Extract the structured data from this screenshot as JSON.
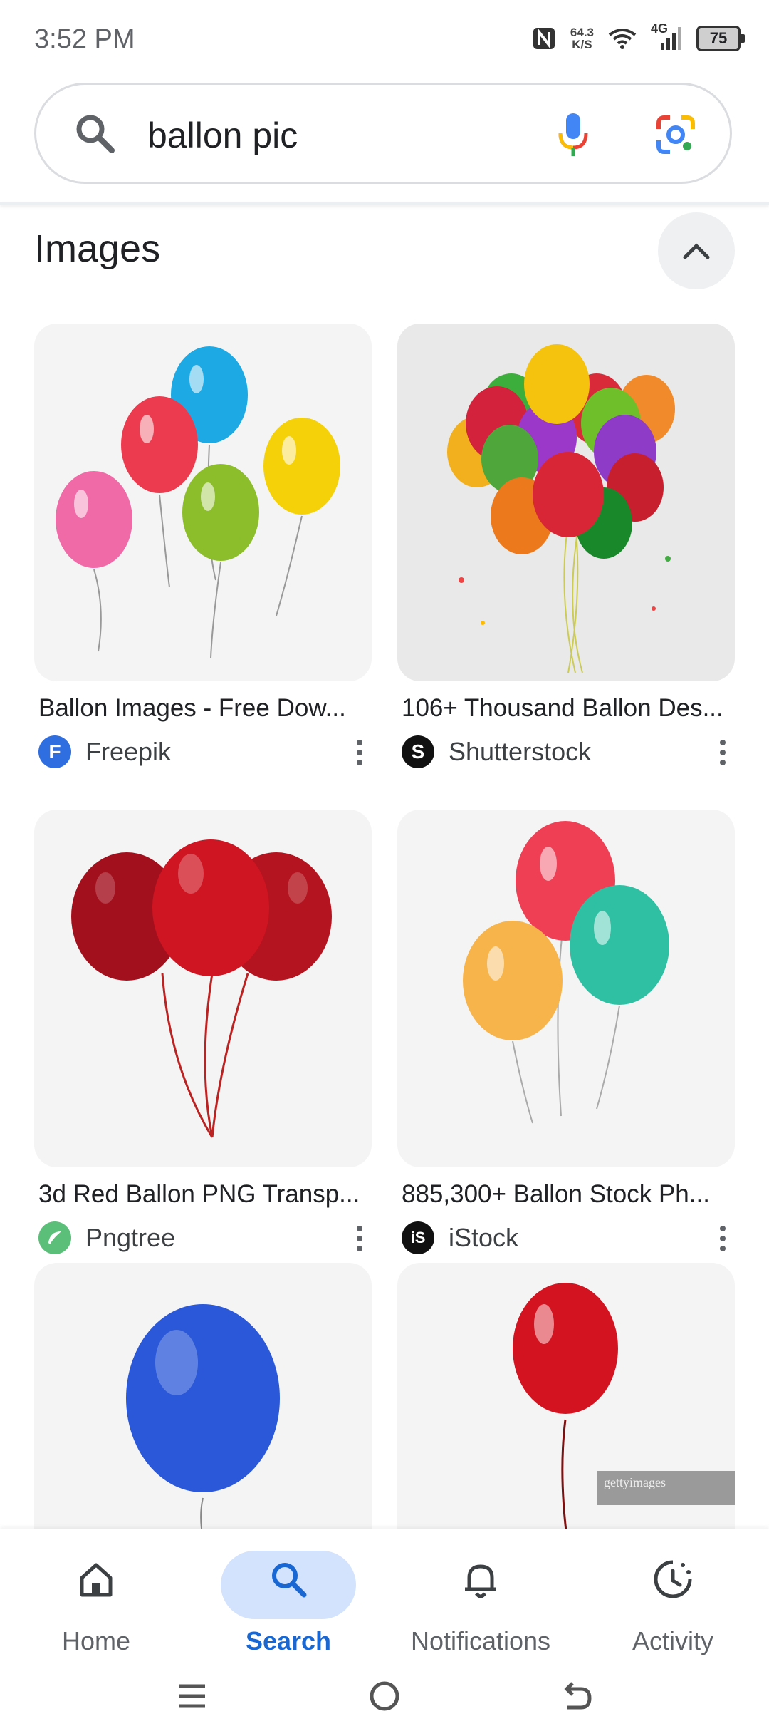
{
  "status": {
    "time": "3:52 PM",
    "net_speed_value": "64.3",
    "net_speed_unit": "K/S",
    "network": "4G",
    "battery": "75"
  },
  "search": {
    "query": "ballon pic"
  },
  "images_section": {
    "title": "Images"
  },
  "results": [
    {
      "caption": "Ballon Images - Free Dow...",
      "source": "Freepik",
      "favicon_letter": "F",
      "favicon_color": "#2f6ee0"
    },
    {
      "caption": "106+ Thousand Ballon Des...",
      "source": "Shutterstock",
      "favicon_letter": "S",
      "favicon_color": "#111111"
    },
    {
      "caption": "3d Red Ballon PNG Transp...",
      "source": "Pngtree",
      "favicon_letter": "",
      "favicon_color": "#5bbf7a"
    },
    {
      "caption": "885,300+ Ballon Stock Ph...",
      "source": "iStock",
      "favicon_letter": "iS",
      "favicon_color": "#111111"
    },
    {
      "watermark": "gettyimages"
    }
  ],
  "bottom_nav": [
    {
      "label": "Home",
      "icon": "home-icon"
    },
    {
      "label": "Search",
      "icon": "search-icon",
      "active": true
    },
    {
      "label": "Notifications",
      "icon": "bell-icon"
    },
    {
      "label": "Activity",
      "icon": "activity-icon"
    }
  ],
  "colors": {
    "accent": "#1967d2",
    "active_pill": "#d3e3fd"
  }
}
